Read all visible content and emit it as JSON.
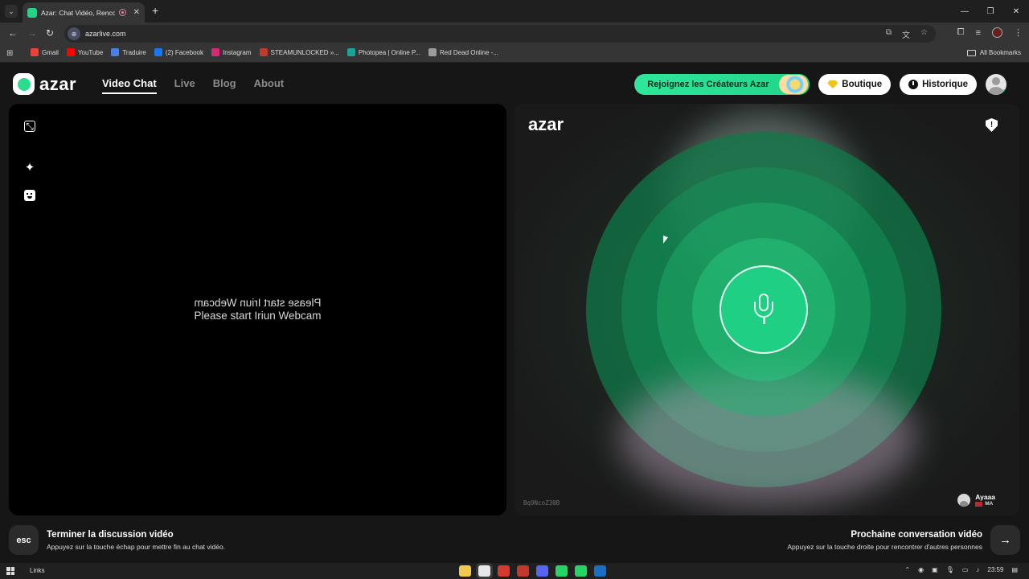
{
  "browser": {
    "tab_title": "Azar: Chat Vidéo, Rencontre",
    "url": "azarlive.com",
    "bookmarks": [
      {
        "label": "Gmail",
        "color": "#ea4335"
      },
      {
        "label": "YouTube",
        "color": "#ff0000"
      },
      {
        "label": "Traduire",
        "color": "#4a7fe8"
      },
      {
        "label": "(2) Facebook",
        "color": "#1877f2"
      },
      {
        "label": "Instagram",
        "color": "#d62976"
      },
      {
        "label": "STEAMUNLOCKED »...",
        "color": "#c0392b"
      },
      {
        "label": "Photopea | Online P...",
        "color": "#18a497"
      },
      {
        "label": "Red Dead Online -...",
        "color": "#9b9b9b"
      }
    ],
    "all_bookmarks": "All Bookmarks"
  },
  "header": {
    "logo_text": "azar",
    "nav": {
      "video_chat": "Video Chat",
      "live": "Live",
      "blog": "Blog",
      "about": "About"
    },
    "creators_btn": "Rejoignez les Créateurs Azar",
    "boutique_btn": "Boutique",
    "historique_btn": "Historique"
  },
  "left_panel": {
    "cam_message": "Please start Iriun Webcam"
  },
  "right_panel": {
    "logo_text": "azar",
    "shield_text": "!",
    "user_code": "Bq9NcoZ30B",
    "peer_name": "Ayaaa",
    "peer_country": "MA"
  },
  "footer": {
    "esc_key": "esc",
    "end_title": "Terminer la discussion vidéo",
    "end_sub": "Appuyez sur la touche échap pour mettre fin au chat vidéo.",
    "next_title": "Prochaine conversation vidéo",
    "next_sub": "Appuyez sur la touche droite pour rencontrer d'autres personnes",
    "next_arrow": "→"
  },
  "taskbar": {
    "links_label": "Links",
    "time": "23:59",
    "apps": [
      "file-explorer",
      "chrome",
      "media-app",
      "app",
      "discord",
      "app",
      "whatsapp",
      "steam"
    ]
  },
  "colors": {
    "accent": "#22d389",
    "ring_dark": "#0f7848",
    "panel_bg": "#000000"
  }
}
